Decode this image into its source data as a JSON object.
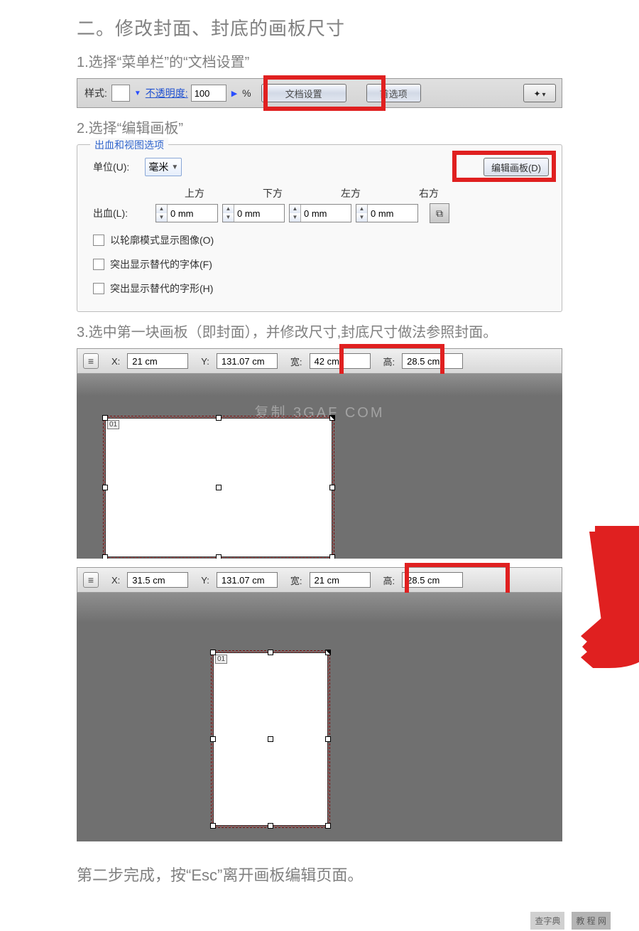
{
  "headings": {
    "main": "二。修改封面、封底的画板尺寸",
    "step1": "1.选择“菜单栏”的“文档设置”",
    "step2": "2.选择“编辑画板”",
    "step3": "3.选中第一块画板（即封面），并修改尺寸,封底尺寸做法参照封面。",
    "footnote": "第二步完成，按“Esc”离开画板编辑页面。"
  },
  "toolbar": {
    "style_label": "样式:",
    "opacity_label": "不透明度:",
    "opacity_value": "100",
    "percent": "%",
    "doc_setup": "文档设置",
    "preferences": "首选项"
  },
  "panel": {
    "title": "出血和视图选项",
    "unit_label": "单位(U):",
    "unit_value": "毫米",
    "edit_artboard": "编辑画板(D)",
    "bleed_label": "出血(L):",
    "directions": {
      "top": "上方",
      "bottom": "下方",
      "left": "左方",
      "right": "右方"
    },
    "bleed_value": "0 mm",
    "chk1": "以轮廓模式显示图像(O)",
    "chk2": "突出显示替代的字体(F)",
    "chk3": "突出显示替代的字形(H)"
  },
  "art1": {
    "x_label": "X:",
    "x": "21 cm",
    "y_label": "Y:",
    "y": "131.07 cm",
    "w_label": "宽:",
    "w": "42 cm",
    "h_label": "高:",
    "h": "28.5 cm",
    "num": "01",
    "watermark": "复制  3GAF  COM"
  },
  "art2": {
    "x_label": "X:",
    "x": "31.5 cm",
    "y_label": "Y:",
    "y": "131.07 cm",
    "w_label": "宽:",
    "w": "21 cm",
    "h_label": "高:",
    "h": "28.5 cm",
    "num": "01"
  },
  "footer": {
    "tag1": "查字典",
    "tag2": "教 程 网"
  }
}
